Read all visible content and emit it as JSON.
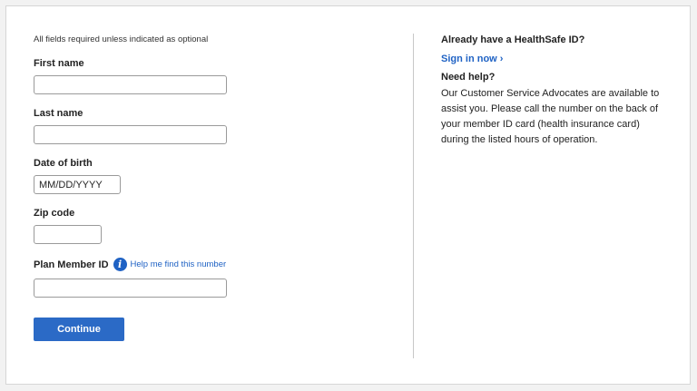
{
  "form": {
    "note": "All fields required unless indicated as optional",
    "first_name": {
      "label": "First name",
      "value": ""
    },
    "last_name": {
      "label": "Last name",
      "value": ""
    },
    "dob": {
      "label": "Date of birth",
      "placeholder": "MM/DD/YYYY"
    },
    "zip": {
      "label": "Zip code",
      "value": ""
    },
    "member_id": {
      "label": "Plan Member ID",
      "help_link": "Help me find this number",
      "info_icon": "info-icon"
    },
    "continue_label": "Continue"
  },
  "sidebar": {
    "title": "Already have a HealthSafe ID?",
    "sign_in": "Sign in now ›",
    "help_title": "Need help?",
    "help_text": "Our Customer Service Advocates are available to assist you. Please call the number on the back of your member ID card (health insurance card) during the listed hours of operation."
  },
  "colors": {
    "accent": "#2b6ac6",
    "link": "#1f62c4",
    "border": "#9a9a9a"
  }
}
